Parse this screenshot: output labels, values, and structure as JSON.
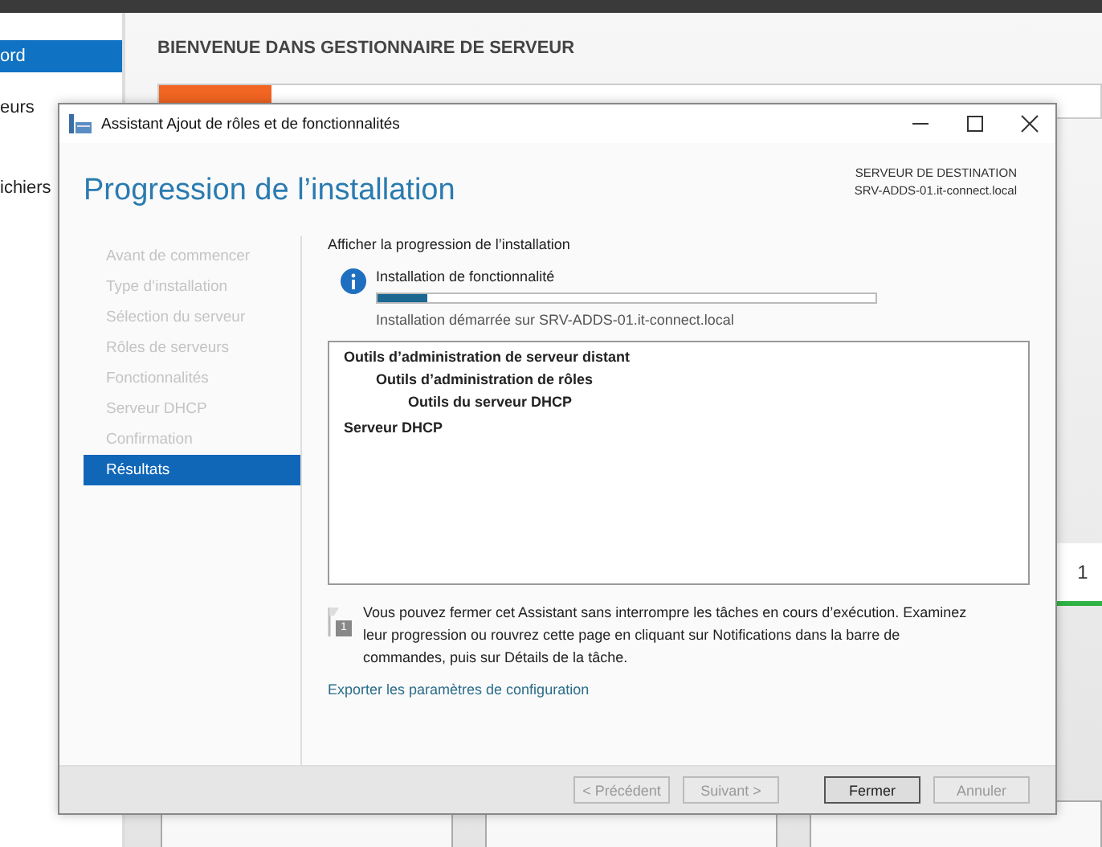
{
  "background": {
    "sidebar_items": [
      {
        "label": "ord",
        "selected": true
      },
      {
        "label": "eurs",
        "selected": false
      },
      {
        "label": "ichiers",
        "selected": false
      }
    ],
    "heading": "BIENVENUE DANS GESTIONNAIRE DE SERVEUR",
    "tile_count": "1"
  },
  "window": {
    "title": "Assistant Ajout de rôles et de fonctionnalités",
    "heading": "Progression de l’installation",
    "destination_label": "SERVEUR DE DESTINATION",
    "destination_server": "SRV-ADDS-01.it-connect.local",
    "steps": [
      {
        "label": "Avant de commencer",
        "selected": false
      },
      {
        "label": "Type d’installation",
        "selected": false
      },
      {
        "label": "Sélection du serveur",
        "selected": false
      },
      {
        "label": "Rôles de serveurs",
        "selected": false
      },
      {
        "label": "Fonctionnalités",
        "selected": false
      },
      {
        "label": "Serveur DHCP",
        "selected": false
      },
      {
        "label": "Confirmation",
        "selected": false
      },
      {
        "label": "Résultats",
        "selected": true
      }
    ],
    "section_title": "Afficher la progression de l’installation",
    "status": "Installation de fonctionnalité",
    "progress": {
      "level": 0.1
    },
    "started": "Installation démarrée sur SRV-ADDS-01.it-connect.local",
    "features": [
      {
        "label": "Outils d’administration de serveur distant",
        "children": [
          {
            "label": "Outils d’administration de rôles",
            "children": [
              {
                "label": "Outils du serveur DHCP"
              }
            ]
          }
        ]
      },
      {
        "label": "Serveur DHCP"
      }
    ],
    "note": "Vous pouvez fermer cet Assistant sans interrompre les tâches en cours d’exécution. Examinez leur progression ou rouvrez cette page en cliquant sur Notifications dans la barre de commandes, puis sur Détails de la tâche.",
    "note_badge": "1",
    "export_link": "Exporter les paramètres de configuration",
    "buttons": [
      {
        "label": "< Précédent",
        "disabled": true,
        "default": false
      },
      {
        "label": "Suivant >",
        "disabled": true,
        "default": false
      },
      {
        "label": "Fermer",
        "disabled": false,
        "default": true
      },
      {
        "label": "Annuler",
        "disabled": true,
        "default": false
      }
    ]
  }
}
